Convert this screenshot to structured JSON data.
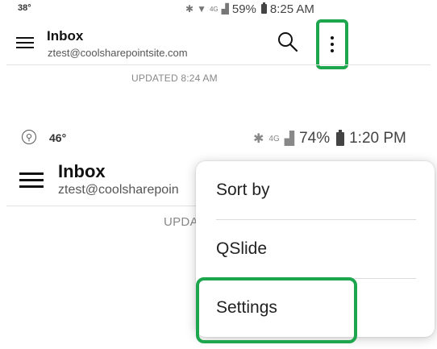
{
  "top_screenshot": {
    "status_bar": {
      "temperature": "38°",
      "network_label": "4G",
      "battery_percent": "59%",
      "time": "8:25 AM"
    },
    "header": {
      "title": "Inbox",
      "account_email": "ztest@coolsharepointsite.com"
    },
    "updated_text": "UPDATED 8:24 AM"
  },
  "bottom_screenshot": {
    "status_bar": {
      "temperature": "46°",
      "network_label": "4G",
      "battery_percent": "74%",
      "time": "1:20 PM"
    },
    "header": {
      "title": "Inbox",
      "account_email_visible": "ztest@coolsharepoin"
    },
    "updated_text_visible": "UPDA"
  },
  "overflow_menu": {
    "items": [
      {
        "label": "Sort by"
      },
      {
        "label": "QSlide"
      },
      {
        "label": "Settings"
      }
    ]
  },
  "colors": {
    "highlight": "#1ea64f",
    "text_primary": "#111111",
    "text_secondary": "#555555"
  },
  "icons": [
    "menu-icon",
    "search-icon",
    "more-vert-icon",
    "bluetooth-icon",
    "wifi-icon",
    "signal-icon",
    "battery-icon",
    "walking-icon"
  ]
}
